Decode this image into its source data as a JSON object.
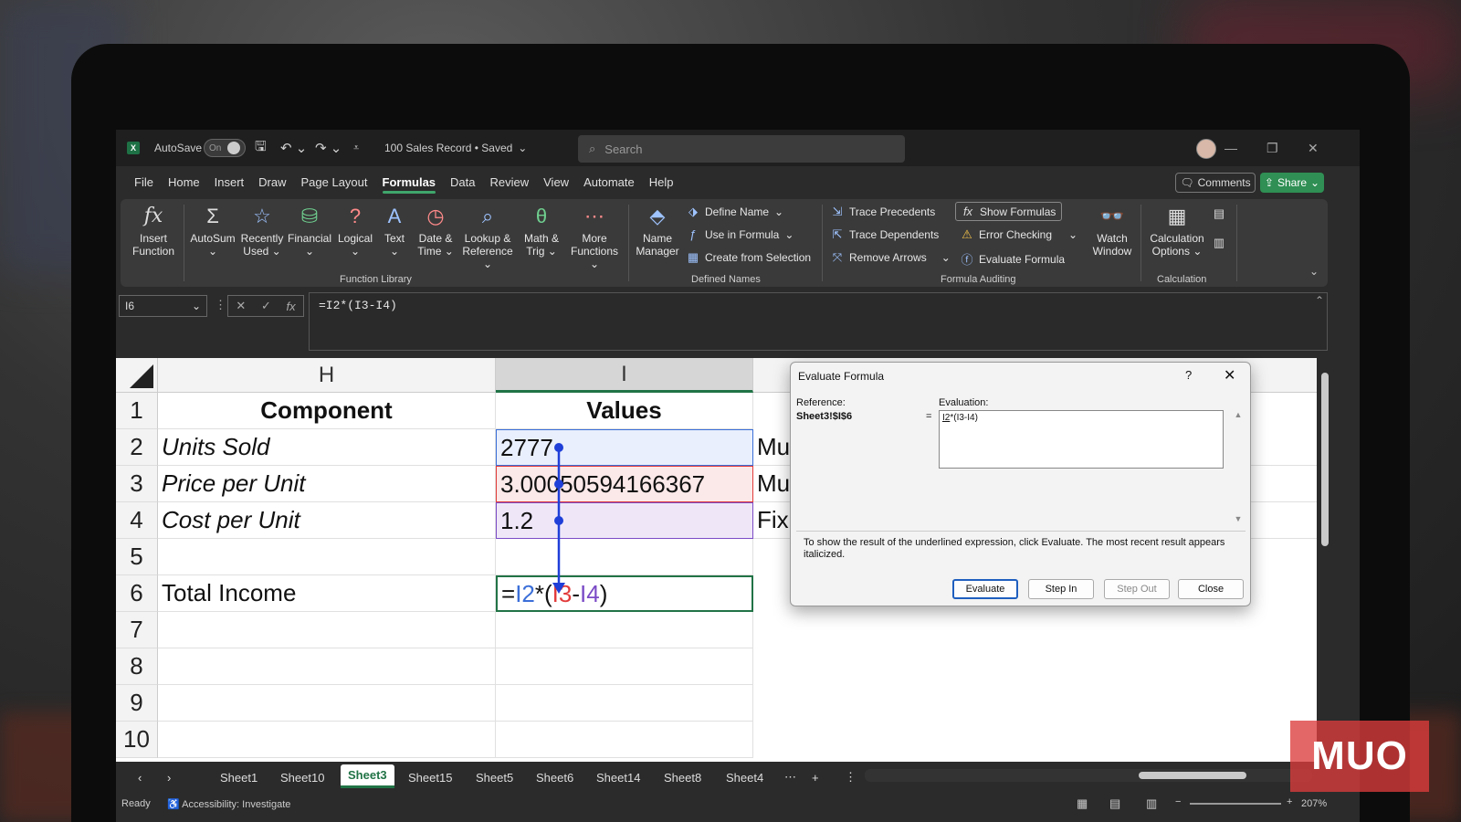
{
  "title_bar": {
    "autosave_label": "AutoSave",
    "autosave_state": "On",
    "document_title": "100 Sales Record • Saved",
    "search_placeholder": "Search"
  },
  "menu": {
    "items": [
      "File",
      "Home",
      "Insert",
      "Draw",
      "Page Layout",
      "Formulas",
      "Data",
      "Review",
      "View",
      "Automate",
      "Help"
    ],
    "active": "Formulas",
    "comments_label": "Comments",
    "share_label": "Share"
  },
  "ribbon": {
    "function_library": {
      "buttons": [
        {
          "l1": "Insert",
          "l2": "Function",
          "icon": "fx-icon"
        },
        {
          "l1": "AutoSum",
          "l2": "⌄",
          "icon": "sigma-icon"
        },
        {
          "l1": "Recently",
          "l2": "Used ⌄",
          "icon": "star-icon"
        },
        {
          "l1": "Financial",
          "l2": "⌄",
          "icon": "coins-icon"
        },
        {
          "l1": "Logical",
          "l2": "⌄",
          "icon": "question-icon"
        },
        {
          "l1": "Text",
          "l2": "⌄",
          "icon": "text-icon"
        },
        {
          "l1": "Date &",
          "l2": "Time ⌄",
          "icon": "clock-icon"
        },
        {
          "l1": "Lookup &",
          "l2": "Reference ⌄",
          "icon": "magnifier-icon"
        },
        {
          "l1": "Math &",
          "l2": "Trig ⌄",
          "icon": "theta-icon"
        },
        {
          "l1": "More",
          "l2": "Functions ⌄",
          "icon": "more-icon"
        }
      ],
      "label": "Function Library"
    },
    "defined_names": {
      "name_manager_l1": "Name",
      "name_manager_l2": "Manager",
      "define_name": "Define Name",
      "use_in_formula": "Use in Formula",
      "create_from_selection": "Create from Selection",
      "label": "Defined Names"
    },
    "formula_auditing": {
      "trace_precedents": "Trace Precedents",
      "trace_dependents": "Trace Dependents",
      "remove_arrows": "Remove Arrows",
      "show_formulas": "Show Formulas",
      "error_checking": "Error Checking",
      "evaluate_formula": "Evaluate Formula",
      "watch_l1": "Watch",
      "watch_l2": "Window",
      "label": "Formula Auditing"
    },
    "calculation": {
      "options_l1": "Calculation",
      "options_l2": "Options ⌄",
      "label": "Calculation"
    }
  },
  "formula_bar": {
    "name_box": "I6",
    "formula": "=I2*(I3-I4)"
  },
  "grid": {
    "columns": [
      "H",
      "I"
    ],
    "rows": [
      "1",
      "2",
      "3",
      "4",
      "5",
      "6",
      "7",
      "8",
      "9",
      "10"
    ],
    "H": [
      "Component",
      "Units Sold",
      "Price per Unit",
      "Cost per Unit",
      "",
      "Total Income",
      "",
      "",
      "",
      ""
    ],
    "I": [
      "Values",
      "2777",
      "3.00050594166367",
      "1.2",
      "",
      "",
      "",
      "",
      "",
      ""
    ],
    "J_partial": [
      "",
      "Mu",
      "Mu",
      "Fix",
      "",
      "",
      "",
      "",
      "",
      ""
    ],
    "i6_parts": {
      "eq": "=",
      "ref1": "I2",
      "op1": "*(",
      "ref2": "I3",
      "op2": "-",
      "ref3": "I4",
      "close": ")"
    }
  },
  "dialog": {
    "title": "Evaluate Formula",
    "help": "?",
    "reference_label": "Reference:",
    "reference_value": "Sheet3!$I$6",
    "equals": "=",
    "evaluation_label": "Evaluation:",
    "evaluation_underlined": "I2",
    "evaluation_rest": "*(I3-I4)",
    "message": "To show the result of the underlined expression, click Evaluate.  The most recent result appears italicized.",
    "buttons": {
      "evaluate": "Evaluate",
      "step_in": "Step In",
      "step_out": "Step Out",
      "close": "Close"
    }
  },
  "sheet_tabs": {
    "tabs": [
      "Sheet1",
      "Sheet10",
      "Sheet3",
      "Sheet15",
      "Sheet5",
      "Sheet6",
      "Sheet14",
      "Sheet8",
      "Sheet4"
    ],
    "active": "Sheet3"
  },
  "status_bar": {
    "ready": "Ready",
    "accessibility": "Accessibility: Investigate",
    "zoom": "207%"
  },
  "watermark": "MUO",
  "colors": {
    "excel_green": "#217346",
    "ref_blue": "#3b6fd8",
    "ref_red": "#e23b3b",
    "ref_purple": "#7b4bc6",
    "arrow_blue": "#1f3fd8"
  }
}
